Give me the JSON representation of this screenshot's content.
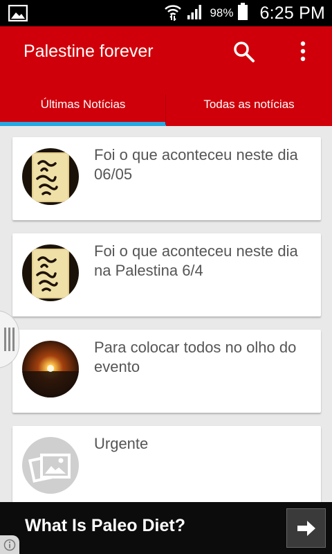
{
  "status_bar": {
    "battery_percent": "98%",
    "time": "6:25 PM",
    "icons": [
      "image-notification-icon",
      "wifi-icon",
      "signal-icon",
      "battery-icon"
    ]
  },
  "app_bar": {
    "title": "Palestine forever",
    "actions": [
      "search-icon",
      "more-vert-icon"
    ],
    "color": "#d0000a"
  },
  "tabs": [
    {
      "label": "Últimas Notícias",
      "selected": true
    },
    {
      "label": "Todas as notícias",
      "selected": false
    }
  ],
  "accent_color": "#27a9e1",
  "news": [
    {
      "title": "Foi o que aconteceu neste dia 06/05",
      "thumb": "arabic-text-thumb"
    },
    {
      "title": "Foi o que aconteceu neste dia na Palestina 6/4",
      "thumb": "arabic-text-thumb"
    },
    {
      "title": "Para colocar todos no olho do evento",
      "thumb": "sunset-thumb"
    },
    {
      "title": "Urgente",
      "thumb": "image-placeholder-icon"
    }
  ],
  "ad": {
    "text": "What Is Paleo Diet?",
    "icons": [
      "arrow-right-icon",
      "info-icon"
    ]
  }
}
